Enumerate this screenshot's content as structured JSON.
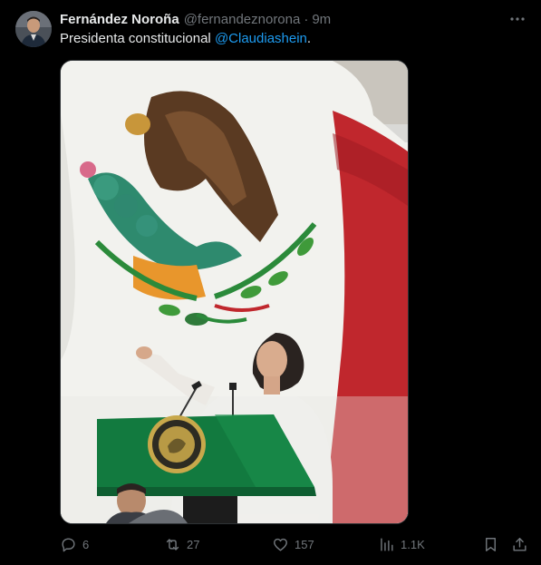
{
  "author": {
    "display_name": "Fernández Noroña",
    "handle": "@fernandeznorona",
    "separator": "·",
    "time": "9m"
  },
  "tweet": {
    "text_before": "Presidenta constitucional ",
    "mention": "@Claudiashein",
    "text_after": "."
  },
  "actions": {
    "replies": "6",
    "retweets": "27",
    "likes": "157",
    "views": "1.1K"
  },
  "icons": {
    "more": "more-dots-icon",
    "reply": "reply-icon",
    "retweet": "retweet-icon",
    "like": "heart-icon",
    "views": "views-icon",
    "bookmark": "bookmark-icon",
    "share": "share-icon"
  },
  "colors": {
    "background": "#000000",
    "text": "#e7e9ea",
    "muted": "#71767b",
    "link": "#1d9bf0",
    "flag_green": "#127a3f",
    "flag_red": "#c0272d"
  }
}
